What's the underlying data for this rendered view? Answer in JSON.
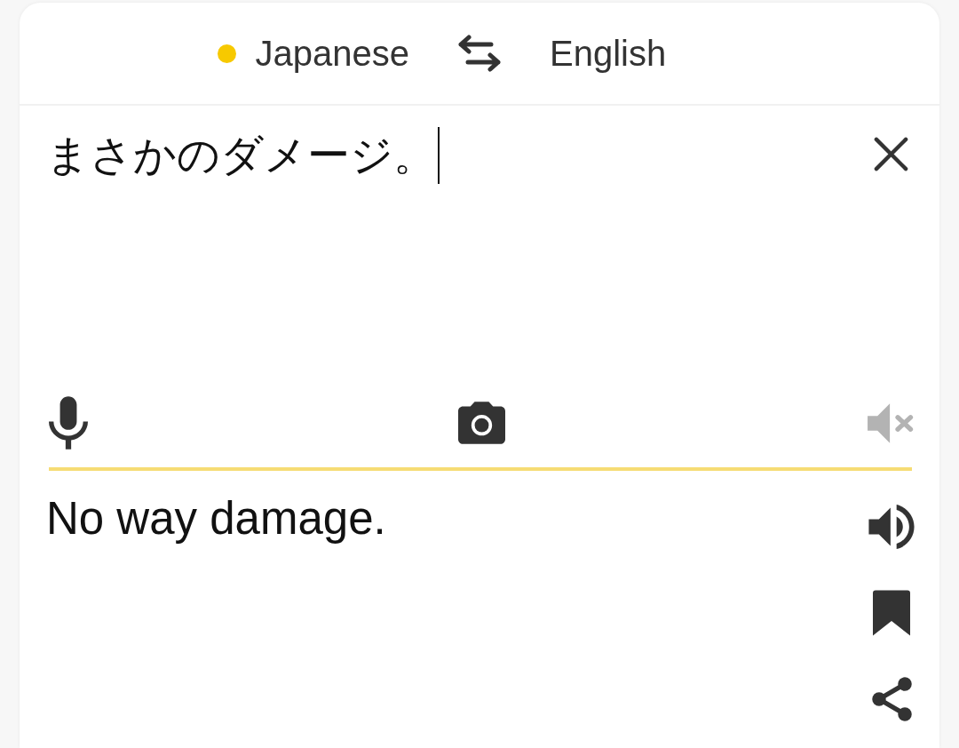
{
  "languages": [
    {
      "label": "Japanese",
      "selected": true
    },
    {
      "label": "English",
      "selected": false
    }
  ],
  "source": {
    "value": "まさかのダメージ。",
    "focused": true
  },
  "input_tools": [
    {
      "kind": "microphone",
      "disabled": false
    },
    {
      "kind": "camera",
      "disabled": false
    },
    {
      "kind": "speaker",
      "disabled": true
    }
  ],
  "translation": {
    "text": "No way damage.",
    "actions": [
      {
        "kind": "speaker"
      },
      {
        "kind": "bookmark"
      },
      {
        "kind": "share"
      }
    ]
  }
}
